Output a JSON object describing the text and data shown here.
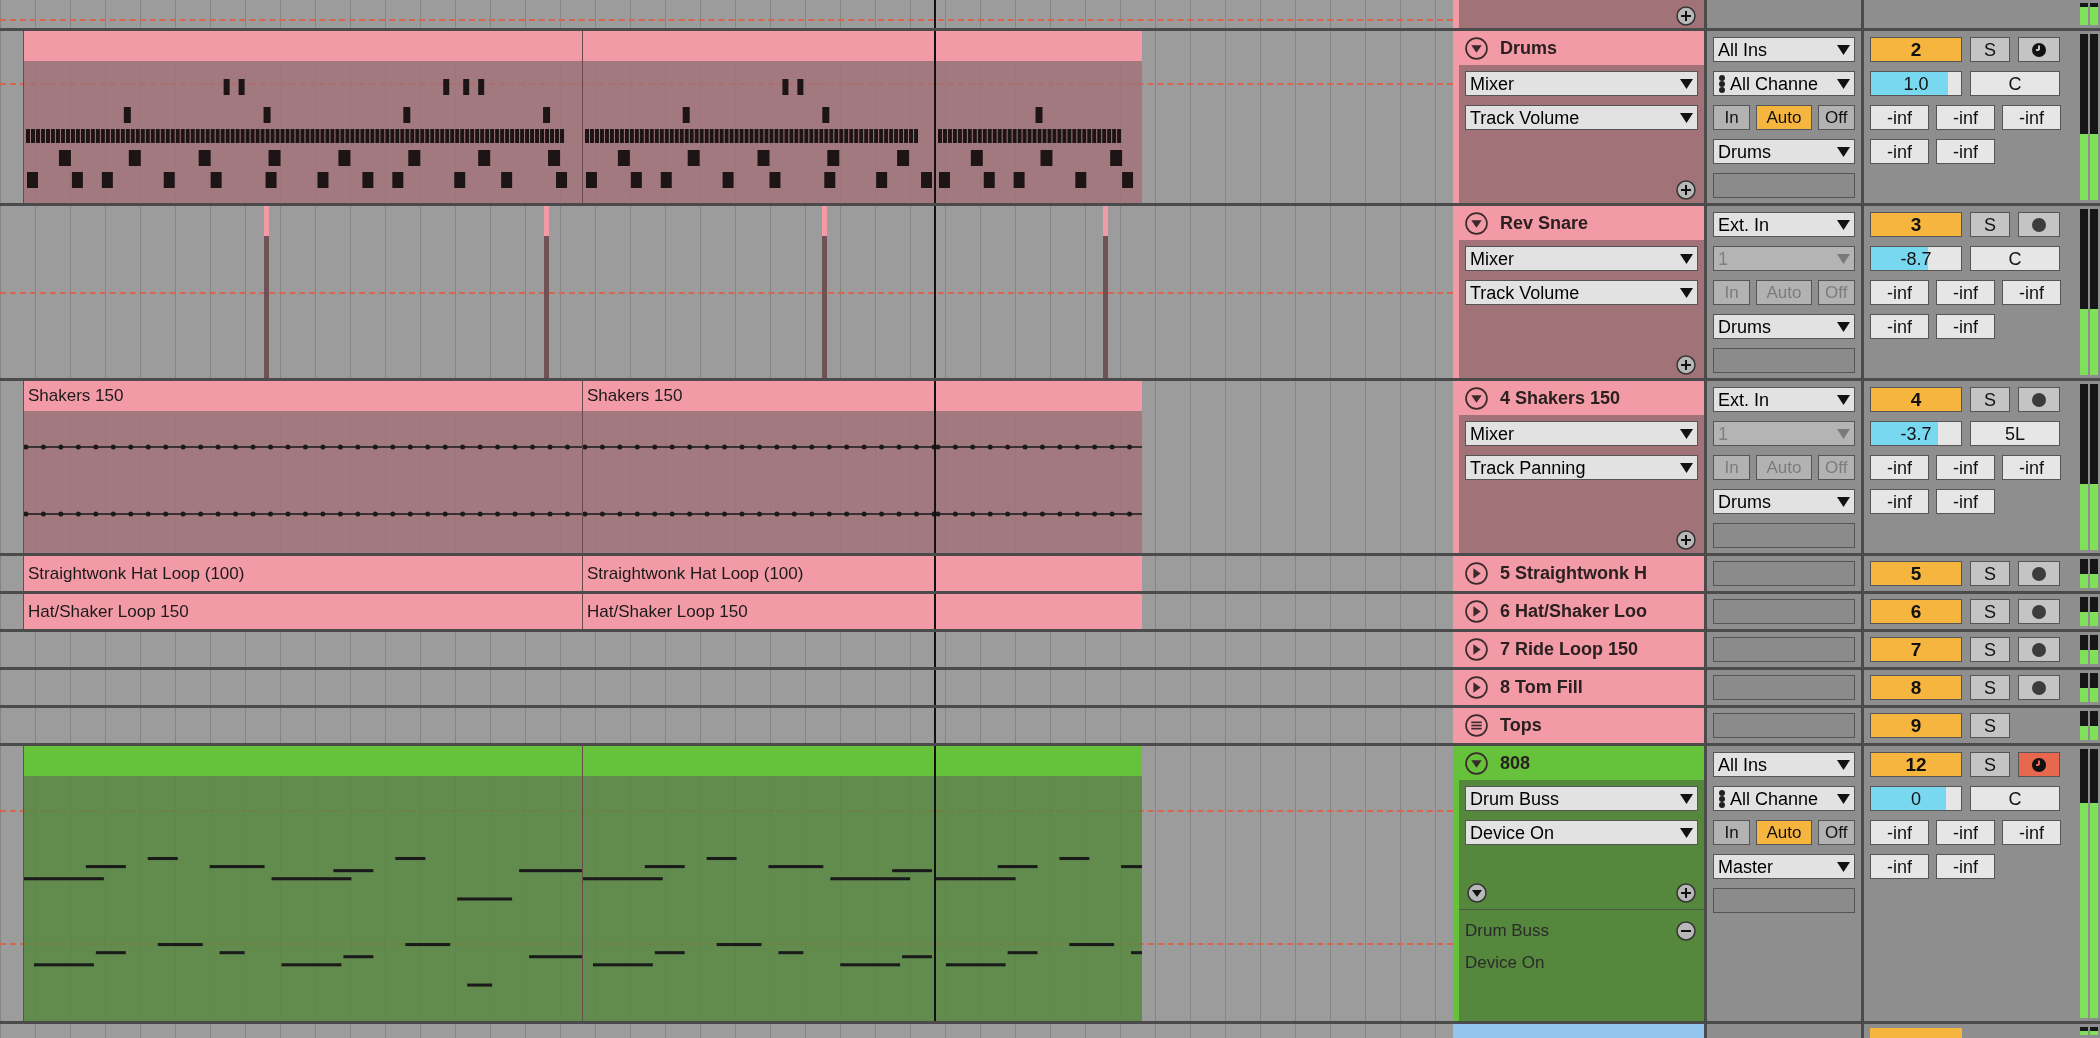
{
  "top_track": {
    "color": "#f39aa7"
  },
  "tracks": [
    {
      "kind": "expanded",
      "fold_button": {
        "kind": "expanded"
      },
      "name": "Drums",
      "color": "#f39aa7",
      "device": "Mixer",
      "parameter": "Track Volume",
      "input_type": "All Ins",
      "input_channel": "All Channe",
      "input_channel_disabled": false,
      "monitor_disabled": false,
      "monitor": [
        {
          "label": "In",
          "selected": false
        },
        {
          "label": "Auto",
          "selected": true
        },
        {
          "label": "Off",
          "selected": false
        }
      ],
      "output": "Drums",
      "number": "2",
      "solo": "S",
      "arm_button": {
        "kind": "group",
        "on": false
      },
      "volume": {
        "value": "1.0",
        "level": 0.85
      },
      "pan": "C",
      "sends": [
        "-inf",
        "-inf",
        "-inf"
      ],
      "peaks": [
        "-inf",
        "-inf"
      ],
      "clips": [
        {
          "kind": "midi_drums"
        },
        {
          "kind": "midi_drums"
        },
        {
          "kind": "midi_drums"
        }
      ]
    },
    {
      "kind": "expanded",
      "fold_button": {
        "kind": "expanded"
      },
      "name": "Rev Snare",
      "color": "#f39aa7",
      "device": "Mixer",
      "parameter": "Track Volume",
      "input_type": "Ext. In",
      "input_channel": "1",
      "input_channel_disabled": true,
      "monitor_disabled": true,
      "monitor": [
        {
          "label": "In",
          "selected": false
        },
        {
          "label": "Auto",
          "selected": false
        },
        {
          "label": "Off",
          "selected": false
        }
      ],
      "output": "Drums",
      "number": "3",
      "solo": "S",
      "arm_button": {
        "kind": "record",
        "on": false
      },
      "volume": {
        "value": "-8.7",
        "level": 0.63
      },
      "pan": "C",
      "sends": [
        "-inf",
        "-inf",
        "-inf"
      ],
      "peaks": [
        "-inf",
        "-inf"
      ],
      "clips": [
        {
          "kind": "audio"
        },
        {
          "kind": "audio"
        },
        {
          "kind": "audio"
        },
        {
          "kind": "audio"
        }
      ]
    },
    {
      "kind": "expanded",
      "fold_button": {
        "kind": "expanded"
      },
      "name": "4 Shakers 150",
      "color": "#f39aa7",
      "device": "Mixer",
      "parameter": "Track Panning",
      "input_type": "Ext. In",
      "input_channel": "1",
      "input_channel_disabled": true,
      "monitor_disabled": true,
      "monitor": [
        {
          "label": "In",
          "selected": false
        },
        {
          "label": "Auto",
          "selected": false
        },
        {
          "label": "Off",
          "selected": false
        }
      ],
      "output": "Drums",
      "number": "4",
      "solo": "S",
      "arm_button": {
        "kind": "record",
        "on": false
      },
      "volume": {
        "value": "-3.7",
        "level": 0.74
      },
      "pan": "5L",
      "sends": [
        "-inf",
        "-inf",
        "-inf"
      ],
      "peaks": [
        "-inf",
        "-inf"
      ],
      "clips": [
        {
          "kind": "automation",
          "title": "Shakers 150"
        },
        {
          "kind": "automation",
          "title": "Shakers 150"
        },
        {
          "kind": "automation"
        }
      ]
    },
    {
      "kind": "collapsed",
      "fold_button": {
        "kind": "collapsed"
      },
      "name": "5 Straightwonk H",
      "color": "#f39aa7",
      "number": "5",
      "solo": "S",
      "arm_button": {
        "kind": "record",
        "on": false
      },
      "clips": [
        {
          "kind": "plain",
          "title": "Straightwonk Hat Loop (100)"
        },
        {
          "kind": "plain",
          "title": "Straightwonk Hat Loop (100)"
        },
        {
          "kind": "plain"
        }
      ]
    },
    {
      "kind": "collapsed",
      "fold_button": {
        "kind": "collapsed"
      },
      "name": "6 Hat/Shaker Loo",
      "color": "#f39aa7",
      "number": "6",
      "solo": "S",
      "arm_button": {
        "kind": "record",
        "on": false
      },
      "clips": [
        {
          "kind": "plain",
          "title": "Hat/Shaker Loop 150"
        },
        {
          "kind": "plain",
          "title": "Hat/Shaker Loop 150"
        },
        {
          "kind": "plain"
        }
      ]
    },
    {
      "kind": "collapsed",
      "fold_button": {
        "kind": "collapsed"
      },
      "name": "7 Ride Loop 150",
      "color": "#f39aa7",
      "number": "7",
      "solo": "S",
      "arm_button": {
        "kind": "record",
        "on": false
      }
    },
    {
      "kind": "collapsed",
      "fold_button": {
        "kind": "collapsed"
      },
      "name": "8 Tom Fill",
      "color": "#f39aa7",
      "number": "8",
      "solo": "S",
      "arm_button": {
        "kind": "record",
        "on": false
      }
    },
    {
      "kind": "collapsed",
      "fold_button": {
        "kind": "group"
      },
      "name": "Tops",
      "color": "#f39aa7",
      "number": "9",
      "solo": "S"
    },
    {
      "kind": "expanded",
      "fold_button": {
        "kind": "expanded"
      },
      "name": "808",
      "color": "#66c23a",
      "device": "Drum Buss",
      "parameter": "Device On",
      "input_type": "All Ins",
      "input_channel": "All Channe",
      "input_channel_disabled": false,
      "monitor_disabled": false,
      "monitor": [
        {
          "label": "In",
          "selected": false
        },
        {
          "label": "Auto",
          "selected": true
        },
        {
          "label": "Off",
          "selected": false
        }
      ],
      "output": "Master",
      "number": "12",
      "solo": "S",
      "arm_button": {
        "kind": "group",
        "on": true
      },
      "volume": {
        "value": "0",
        "level": 0.83
      },
      "pan": "C",
      "sends": [
        "-inf",
        "-inf",
        "-inf"
      ],
      "peaks": [
        "-inf",
        "-inf"
      ],
      "clips": [
        {
          "kind": "midi_bass"
        },
        {
          "kind": "midi_bass"
        },
        {
          "kind": "midi_bass"
        }
      ],
      "automation_lanes": [
        {
          "device": "Drum Buss",
          "parameter": "Device On"
        }
      ]
    }
  ],
  "cut_off_track": {
    "color": "#93c3ef"
  }
}
